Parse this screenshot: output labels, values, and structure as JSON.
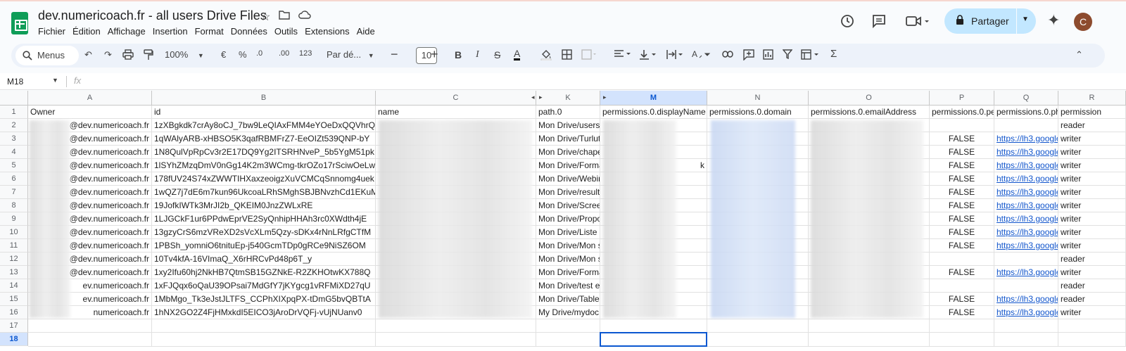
{
  "doc": {
    "title": "dev.numericoach.fr - all users Drive Files"
  },
  "menu": [
    "Fichier",
    "Édition",
    "Affichage",
    "Insertion",
    "Format",
    "Données",
    "Outils",
    "Extensions",
    "Aide"
  ],
  "share": {
    "label": "Partager"
  },
  "avatar": {
    "initial": "C"
  },
  "toolbar": {
    "menus": "Menus",
    "zoom": "100%",
    "currency": "€",
    "percent": "%",
    "dec_less": ".0",
    "dec_more": ".00",
    "number_fmt": "123",
    "font": "Par dé...",
    "font_size": "10",
    "bold": "B",
    "italic": "I",
    "sigma": "Σ"
  },
  "formula_bar": {
    "cell_ref": "M18",
    "fx": "fx"
  },
  "columns": [
    "A",
    "B",
    "C",
    "K",
    "M",
    "N",
    "O",
    "P",
    "Q",
    "R"
  ],
  "header_row": [
    "Owner",
    "id",
    "name",
    "path.0",
    "permissions.0.displayName",
    "permissions.0.domain",
    "permissions.0.emailAddress",
    "permissions.0.pe",
    "permissions.0.ph",
    "permission"
  ],
  "rows": [
    {
      "num": "2",
      "owner": "@dev.numericoach.fr",
      "id": "1zXBgkdk7crAy8oCJ_7bw9LeQIAxFMM4eYOeDxQQVhrQ",
      "path": "Mon Drive/users",
      "domain_blur": true,
      "pe": "",
      "ph": "",
      "role": "reader"
    },
    {
      "num": "3",
      "owner": "@dev.numericoach.fr",
      "id": "1qWAlyARB-xHBSO5K3qafRBMFrZ7-EeOIZt539QNP-bY",
      "path": "Mon Drive/Turlut",
      "pe": "FALSE",
      "ph": "https://lh3.google",
      "role": "writer"
    },
    {
      "num": "4",
      "owner": "@dev.numericoach.fr",
      "id": "1N8QulVpRpCv3r2E17DQ9Yg2ITSRHNveP_5b5YgM51pk",
      "path": "Mon Drive/chape",
      "pe": "FALSE",
      "ph": "https://lh3.google",
      "role": "writer"
    },
    {
      "num": "5",
      "owner": "@dev.numericoach.fr",
      "id": "1lSYhZMzqDmV0nGg14K2m3WCmg-tkrOZo17rSciwOeLw",
      "path": "Mon Drive/Forma",
      "disp_tail": "k",
      "pe": "FALSE",
      "ph": "https://lh3.google",
      "role": "writer"
    },
    {
      "num": "6",
      "owner": "@dev.numericoach.fr",
      "id": "178fUV24S74xZWWTIHXaxzeoigzXuVCMCqSnnomg4uek",
      "path": "Mon Drive/Webin",
      "pe": "FALSE",
      "ph": "https://lh3.google",
      "role": "writer"
    },
    {
      "num": "7",
      "owner": "@dev.numericoach.fr",
      "id": "1wQZ7j7dE6m7kun96UkcoaLRhSMghSBJBNvzhCd1EKuM",
      "path": "Mon Drive/results",
      "pe": "FALSE",
      "ph": "https://lh3.google",
      "role": "writer"
    },
    {
      "num": "8",
      "owner": "@dev.numericoach.fr",
      "id": "19JofkIWTk3MrJI2b_QKEIM0JnzZWLxRE",
      "path": "Mon Drive/Scree",
      "pe": "FALSE",
      "ph": "https://lh3.google",
      "role": "writer"
    },
    {
      "num": "9",
      "owner": "@dev.numericoach.fr",
      "id": "1LJGCkF1ur6PPdwEprVE2SyQnhipHHAh3rc0XWdth4jE",
      "path": "Mon Drive/Propo",
      "pe": "FALSE",
      "ph": "https://lh3.google",
      "role": "writer"
    },
    {
      "num": "10",
      "owner": "@dev.numericoach.fr",
      "id": "13gzyCrS6mzVReXD2sVcXLm5Qzy-sDKx4rNnLRfgCTfM",
      "path": "Mon Drive/Liste",
      "pe": "FALSE",
      "ph": "https://lh3.google",
      "role": "writer"
    },
    {
      "num": "11",
      "owner": "@dev.numericoach.fr",
      "id": "1PBSh_yomniO6tnituEp-j540GcmTDp0gRCe9NiSZ6OM",
      "path": "Mon Drive/Mon s",
      "pe": "FALSE",
      "ph": "https://lh3.google",
      "role": "writer"
    },
    {
      "num": "12",
      "owner": "@dev.numericoach.fr",
      "id": "10Tv4kfA-16VImaQ_X6rHRCvPd48p6T_y",
      "path": "Mon Drive/Mon su",
      "pe": "",
      "ph": "",
      "role": "reader"
    },
    {
      "num": "13",
      "owner": "@dev.numericoach.fr",
      "id": "1xy2Ifu60hj2NkHB7QtmSB15GZNkE-R2ZKHOtwKX788Q",
      "path": "Mon Drive/Forma",
      "pe": "FALSE",
      "ph": "https://lh3.google",
      "role": "writer"
    },
    {
      "num": "14",
      "owner": "ev.numericoach.fr",
      "id": "1xFJQqx6oQaU39OPsai7MdGfY7jKYgcg1vRFMiXD27qU",
      "path": "Mon Drive/test ex",
      "pe": "",
      "ph": "",
      "role": "reader"
    },
    {
      "num": "15",
      "owner": "ev.numericoach.fr",
      "id": "1MbMgo_Tk3eJstJLTFS_CCPhXIXpqPX-tDmG5bvQBTtA",
      "path": "Mon Drive/Tableau",
      "pe": "FALSE",
      "ph": "https://lh3.google",
      "role": "reader"
    },
    {
      "num": "16",
      "owner": "numericoach.fr",
      "id": "1hNX2GO2Z4FjHMxkdI5EICO3jAroDrVQFj-vUjNUanv0",
      "path": "My Drive/mydoc",
      "pe": "FALSE",
      "ph": "https://lh3.google",
      "role": "writer"
    }
  ],
  "empty_rows": [
    "17",
    "18"
  ]
}
